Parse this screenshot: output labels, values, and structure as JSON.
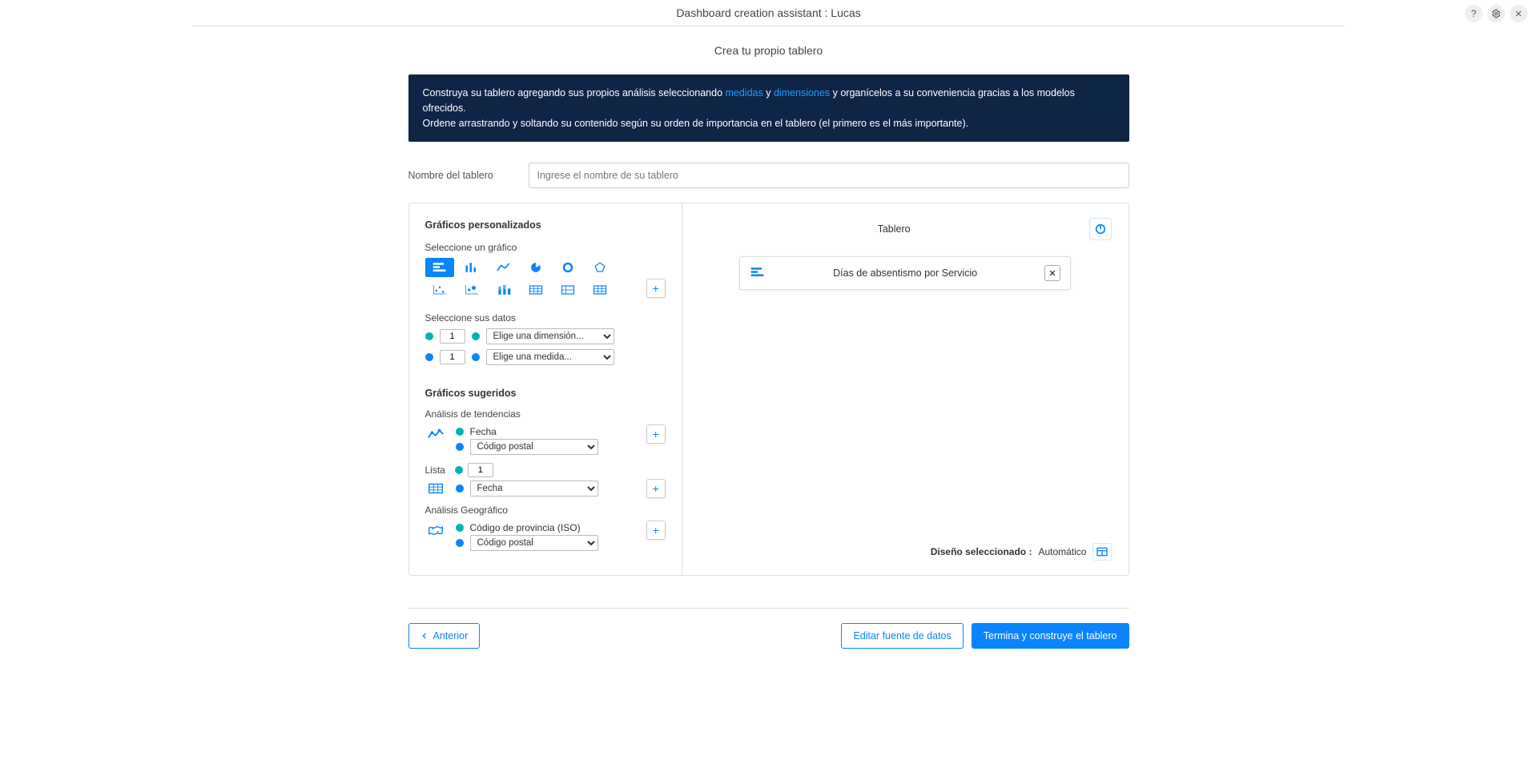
{
  "header": {
    "title": "Dashboard creation assistant : Lucas",
    "subtitle": "Crea tu propio tablero"
  },
  "banner": {
    "part1": "Construya su tablero agregando sus propios análisis seleccionando ",
    "link1": "medidas",
    "part2": " y ",
    "link2": "dimensiones",
    "part3": " y organícelos a su conveniencia gracias a los modelos ofrecidos.",
    "line2": "Ordene arrastrando y soltando su contenido según su orden de importancia en el tablero (el primero es el más importante)."
  },
  "name_field": {
    "label": "Nombre del tablero",
    "placeholder": "Ingrese el nombre de su tablero"
  },
  "left": {
    "custom_title": "Gráficos personalizados",
    "select_chart_label": "Seleccione un gráfico",
    "select_data_label": "Seleccione sus datos",
    "dimension_count": "1",
    "dimension_placeholder": "Elige una dimensión...",
    "measure_count": "1",
    "measure_placeholder": "Elige una medida...",
    "suggested_title": "Gráficos sugeridos",
    "trend": {
      "label": "Análisis de tendencias",
      "dim1": "Fecha",
      "measure_selected": "Código postal"
    },
    "list": {
      "label": "Lista",
      "count": "1",
      "selected": "Fecha"
    },
    "geo": {
      "label": "Análisis Geográfico",
      "dim1": "Código de provincia (ISO)",
      "measure_selected": "Código postal"
    }
  },
  "right": {
    "title": "Tablero",
    "card_title": "Días de absentismo por Servicio",
    "design_label": "Diseño seleccionado :",
    "design_value": "Automático"
  },
  "footer": {
    "prev": "Anterior",
    "edit": "Editar fuente de datos",
    "finish": "Termina y construye el tablero"
  }
}
